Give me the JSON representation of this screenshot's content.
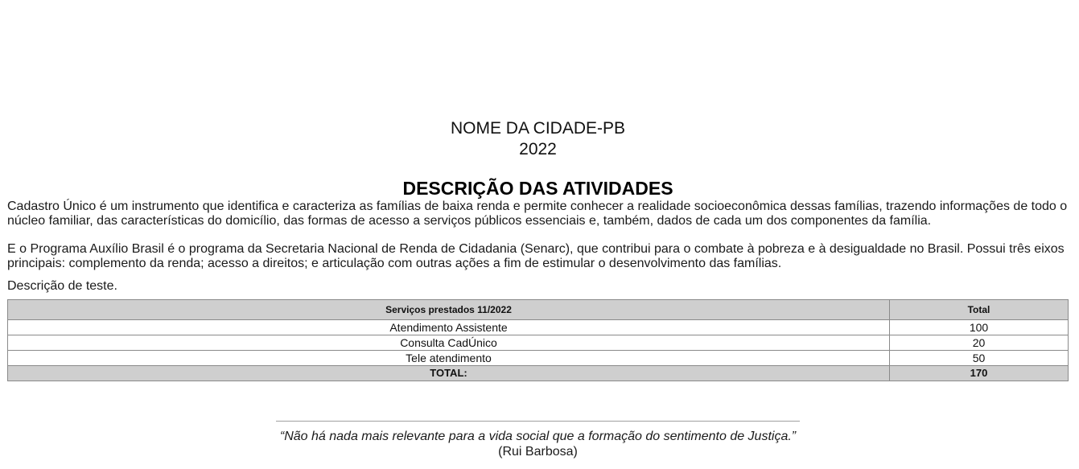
{
  "header": {
    "city": "NOME DA CIDADE-PB",
    "year": "2022"
  },
  "section": {
    "title": "DESCRIÇÃO DAS ATIVIDADES"
  },
  "paragraphs": [
    " Cadastro Único é um instrumento que identifica e caracteriza as famílias de baixa renda e permite conhecer a realidade socioeconômica dessas famílias, trazendo informações de todo o núcleo familiar, das características do domicílio, das formas de acesso a serviços públicos essenciais e, também, dados de cada um dos componentes da família.",
    " E o Programa Auxílio Brasil é o programa da Secretaria Nacional de Renda de Cidadania (Senarc), que contribui para o combate à pobreza e à desigualdade no Brasil. Possui três eixos principais: complemento da renda; acesso a direitos; e articulação com outras ações a fim de estimular o desenvolvimento das famílias.",
    "Descrição de teste."
  ],
  "table": {
    "headers": [
      "Serviços prestados 11/2022",
      "Total"
    ],
    "rows": [
      [
        "Atendimento Assistente",
        "100"
      ],
      [
        "Consulta CadÚnico",
        "20"
      ],
      [
        "Tele atendimento",
        "50"
      ]
    ],
    "footer": [
      "TOTAL:",
      "170"
    ]
  },
  "quote": {
    "text": "“Não há nada mais relevante para a vida social que a formação do sentimento de Justiça.”",
    "author": "(Rui Barbosa)"
  }
}
